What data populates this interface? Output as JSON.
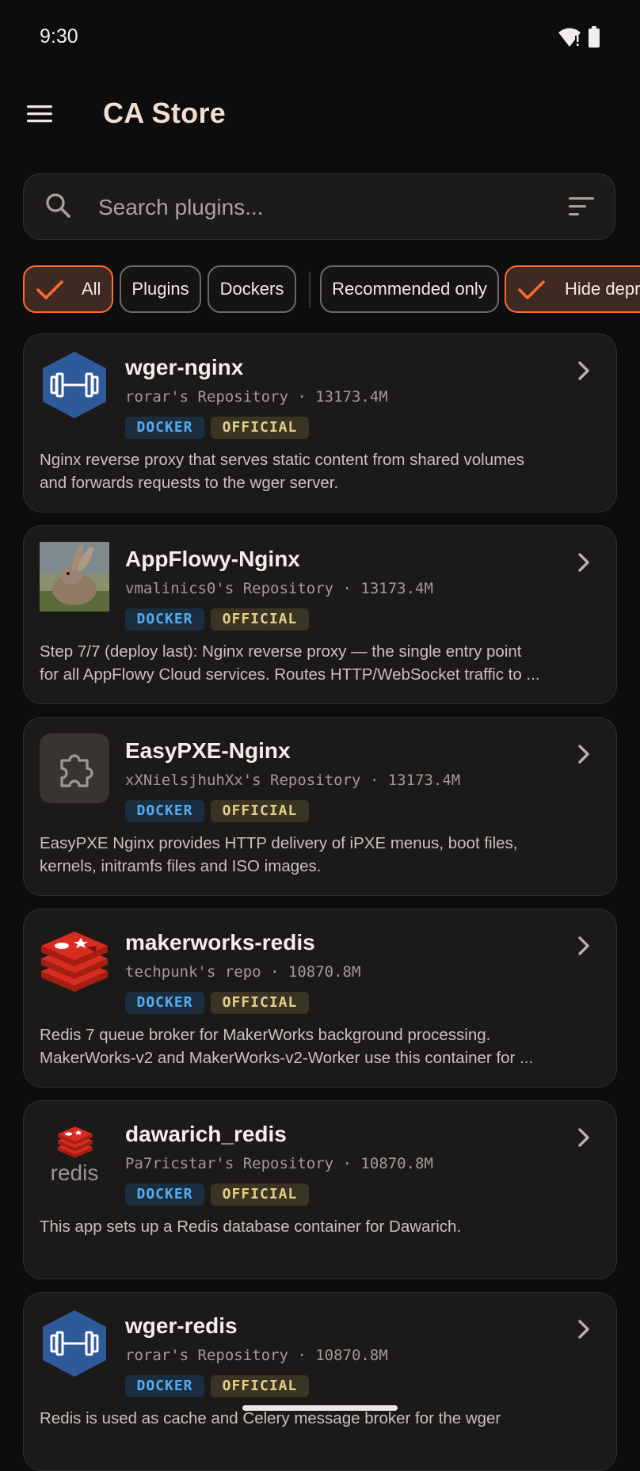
{
  "status_bar": {
    "time": "9:30"
  },
  "app_bar": {
    "title": "CA Store"
  },
  "search": {
    "placeholder": "Search plugins..."
  },
  "filters": {
    "chips": [
      {
        "label": "All",
        "selected": true
      },
      {
        "label": "Plugins",
        "selected": false
      },
      {
        "label": "Dockers",
        "selected": false
      },
      {
        "label": "Recommended only",
        "selected": false
      },
      {
        "label": "Hide depre",
        "selected": true
      }
    ]
  },
  "badges": {
    "docker": "DOCKER",
    "official": "OFFICIAL"
  },
  "cards": [
    {
      "title": "wger-nginx",
      "meta": "rorar's Repository · 13173.4M",
      "icon": "wger-dumbbell-icon",
      "desc_line1": "Nginx reverse proxy that serves static content from shared volumes",
      "desc_line2": "and forwards requests to the wger server."
    },
    {
      "title": "AppFlowy-Nginx",
      "meta": "vmalinics0's Repository · 13173.4M",
      "icon": "rabbit-photo",
      "desc_line1": "Step 7/7 (deploy last): Nginx reverse proxy — the single entry point",
      "desc_line2": "for all AppFlowy Cloud services. Routes HTTP/WebSocket traffic to ..."
    },
    {
      "title": "EasyPXE-Nginx",
      "meta": "xXNielsjhuhXx's Repository · 13173.4M",
      "icon": "puzzle-piece-icon",
      "desc_line1": "EasyPXE Nginx provides HTTP delivery of iPXE menus, boot files,",
      "desc_line2": "kernels, initramfs files and ISO images."
    },
    {
      "title": "makerworks-redis",
      "meta": "techpunk's repo · 10870.8M",
      "icon": "redis-cube-icon",
      "desc_line1": "Redis 7 queue broker for MakerWorks background processing.",
      "desc_line2": "MakerWorks-v2 and MakerWorks-v2-Worker use this container for ..."
    },
    {
      "title": "dawarich_redis",
      "meta": "Pa7ricstar's Repository · 10870.8M",
      "icon": "redis-logo-icon",
      "logo_text": "redis",
      "desc_line1": "This app sets up a Redis database container for Dawarich.",
      "desc_line2": ""
    },
    {
      "title": "wger-redis",
      "meta": "rorar's Repository · 10870.8M",
      "icon": "wger-dumbbell-icon",
      "desc_line1": "Redis is used as cache and Celery message broker for the wger",
      "desc_line2": ""
    }
  ],
  "colors": {
    "accent": "#ff6a2b",
    "background": "#0e0d0d",
    "card": "#1c1a19",
    "docker_badge": "#56acf0",
    "official_badge": "#e4cf86"
  }
}
